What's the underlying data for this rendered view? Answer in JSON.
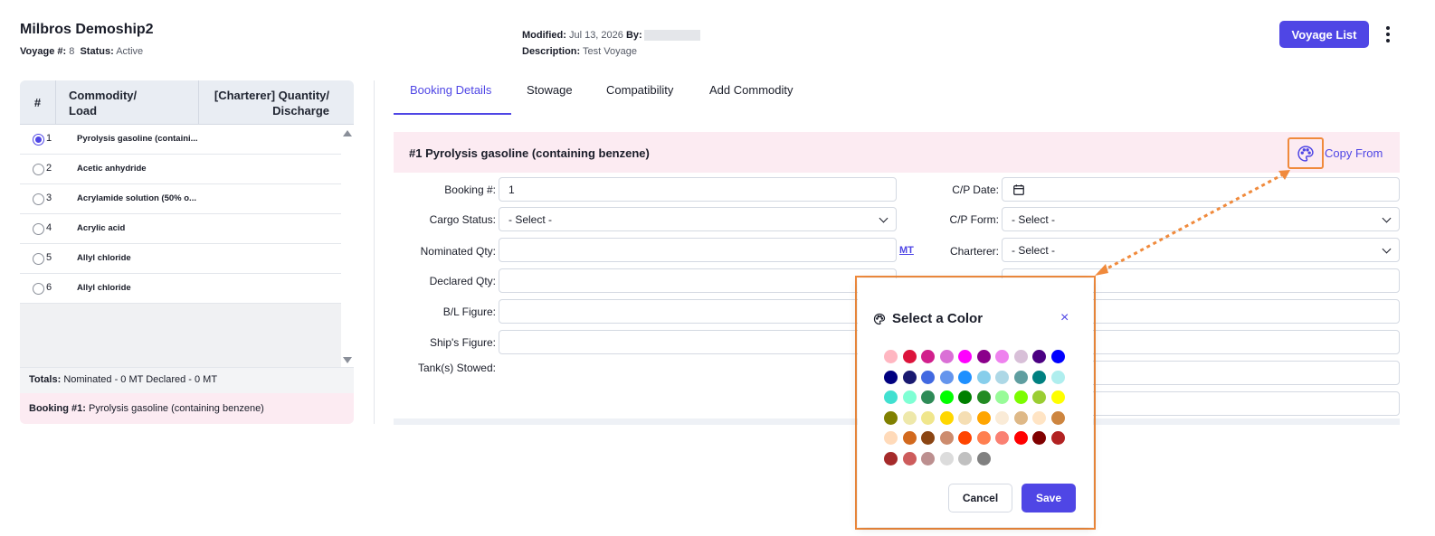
{
  "header": {
    "title": "Milbros Demoship2",
    "voyage_label": "Voyage #:",
    "voyage_value": "8",
    "status_label": "Status:",
    "status_value": "Active",
    "modified_label": "Modified:",
    "modified_value": "Jul 13, 2026",
    "by_label": "By:",
    "description_label": "Description:",
    "description_value": "Test Voyage",
    "voyage_list_button": "Voyage List"
  },
  "table": {
    "col_num": "#",
    "col_commodity_line1": "Commodity/",
    "col_commodity_line2": "Load",
    "col_qty_line1": "[Charterer] Quantity/",
    "col_qty_line2": "Discharge",
    "rows": [
      {
        "num": "1",
        "name": "Pyrolysis gasoline (containi...",
        "selected": true
      },
      {
        "num": "2",
        "name": "Acetic anhydride",
        "selected": false
      },
      {
        "num": "3",
        "name": "Acrylamide solution (50% o...",
        "selected": false
      },
      {
        "num": "4",
        "name": "Acrylic acid",
        "selected": false
      },
      {
        "num": "5",
        "name": "Allyl chloride",
        "selected": false
      },
      {
        "num": "6",
        "name": "Allyl chloride",
        "selected": false
      }
    ],
    "totals_label": "Totals:",
    "totals_value": "Nominated - 0 MT Declared - 0 MT",
    "booking_label": "Booking #1:",
    "booking_value": "Pyrolysis gasoline (containing benzene)"
  },
  "tabs": [
    {
      "label": "Booking Details",
      "active": true
    },
    {
      "label": "Stowage",
      "active": false
    },
    {
      "label": "Compatibility",
      "active": false
    },
    {
      "label": "Add Commodity",
      "active": false
    }
  ],
  "form": {
    "section_title": "#1 Pyrolysis gasoline (containing benzene)",
    "copy_from": "Copy From",
    "booking_no_label": "Booking #:",
    "booking_no_value": "1",
    "cargo_status_label": "Cargo Status:",
    "cargo_status_value": "- Select -",
    "nominated_qty_label": "Nominated Qty:",
    "nominated_qty_value": "",
    "unit_link": "MT",
    "declared_qty_label": "Declared Qty:",
    "bl_figure_label": "B/L Figure:",
    "ships_figure_label": "Ship's Figure:",
    "tanks_stowed_label": "Tank(s) Stowed:",
    "cp_date_label": "C/P Date:",
    "cp_form_label": "C/P Form:",
    "cp_form_value": "- Select -",
    "charterer_label": "Charterer:",
    "charterer_value": "- Select -"
  },
  "color_modal": {
    "title": "Select a Color",
    "close_icon": "×",
    "cancel_button": "Cancel",
    "save_button": "Save",
    "swatches": [
      "#ffb6c1",
      "#dc143c",
      "#d11f8c",
      "#da70d6",
      "#ff00ff",
      "#8b008b",
      "#ee82ee",
      "#d8bfd8",
      "#4b0082",
      "#0000ff",
      "#000080",
      "#191970",
      "#4169e1",
      "#6495ed",
      "#1e90ff",
      "#87ceeb",
      "#add8e6",
      "#5f9ea0",
      "#008080",
      "#afeeee",
      "#40e0d0",
      "#7fffd4",
      "#2e8b57",
      "#00ff00",
      "#008000",
      "#228b22",
      "#98fb98",
      "#7cfc00",
      "#9acd32",
      "#ffff00",
      "#808000",
      "#eee8aa",
      "#f0e68c",
      "#ffd700",
      "#f5deb3",
      "#ffa500",
      "#faebd7",
      "#deb887",
      "#ffe4c4",
      "#cd853f",
      "#ffdab9",
      "#d2691e",
      "#8b4513",
      "#cd8c6e",
      "#ff4500",
      "#ff7f50",
      "#fa8072",
      "#ff0000",
      "#800000",
      "#b22222",
      "#a52a2a",
      "#cd5c5c",
      "#bc8f8f",
      "#dcdcdc",
      "#c0c0c0",
      "#808080"
    ]
  },
  "colors": {
    "accent": "#4f46e5",
    "highlight_outline": "#f08a3c",
    "section_pink": "#fcebf2"
  },
  "icons": {
    "palette": "palette-icon",
    "calendar": "calendar-icon",
    "kebab": "kebab-menu-icon"
  }
}
